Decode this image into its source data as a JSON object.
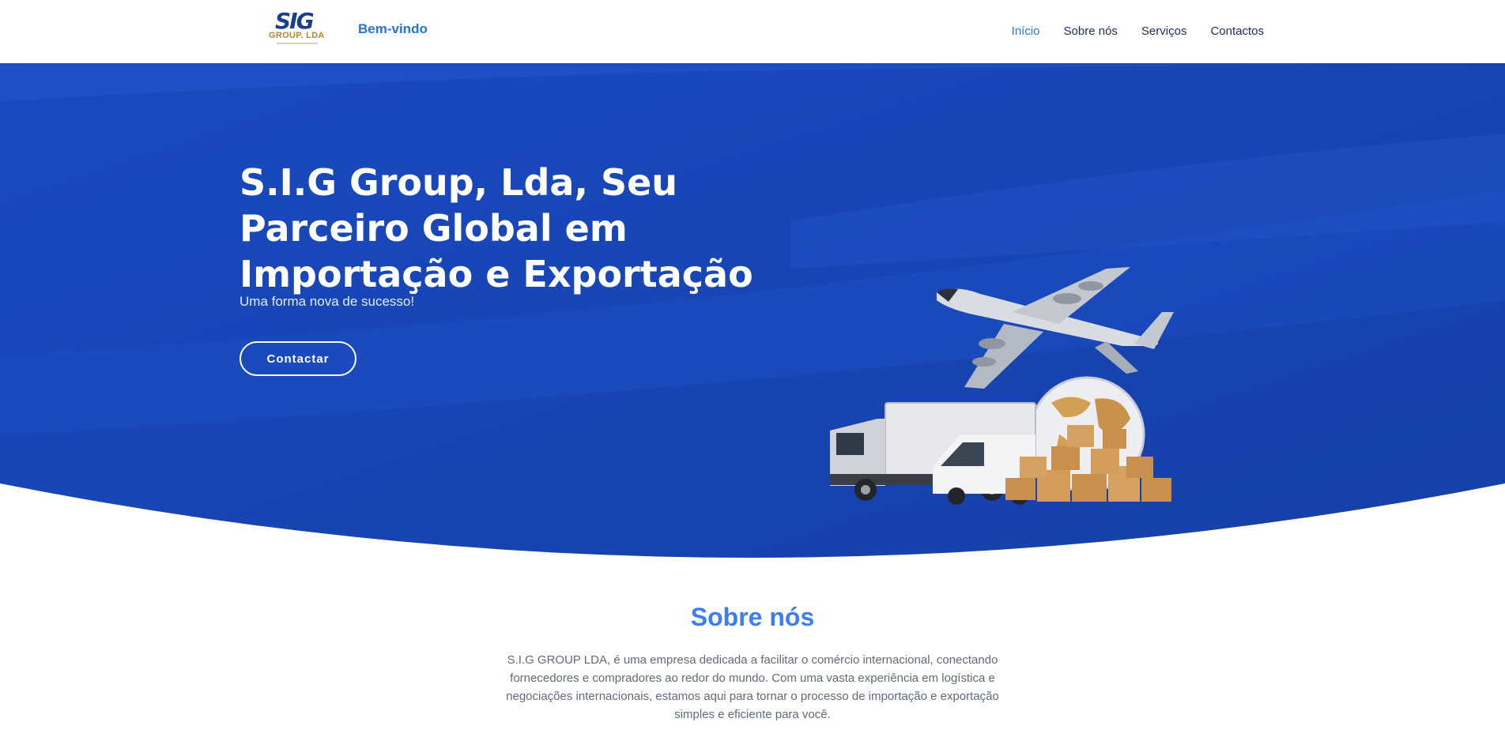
{
  "header": {
    "logo_mark": "SIG",
    "logo_sub": "GROUP. LDA",
    "welcome": "Bem-vindo",
    "nav": [
      {
        "label": "Início",
        "active": true
      },
      {
        "label": "Sobre nós",
        "active": false
      },
      {
        "label": "Serviços",
        "active": false
      },
      {
        "label": "Contactos",
        "active": false
      }
    ]
  },
  "hero": {
    "title": "S.I.G Group, Lda, Seu Parceiro Global em Importação e Exportação",
    "subtitle": "Uma forma nova de sucesso!",
    "cta_label": "Contactar",
    "illustration": [
      "airplane-icon",
      "globe-icon",
      "truck-icon",
      "van-icon",
      "boxes-icon"
    ]
  },
  "about": {
    "title": "Sobre nós",
    "text": "S.I.G GROUP LDA, é uma empresa dedicada a facilitar o comércio internacional, conectando fornecedores e compradores ao redor do mundo. Com uma vasta experiência em logística e negociações internacionais, estamos aqui para tornar o processo de importação e exportação simples e eficiente para você."
  },
  "colors": {
    "hero_blue": "#1846b4",
    "hero_blue_light": "#2a5fd6",
    "accent": "#2a7ad4",
    "about_title": "#3c7ef0"
  }
}
